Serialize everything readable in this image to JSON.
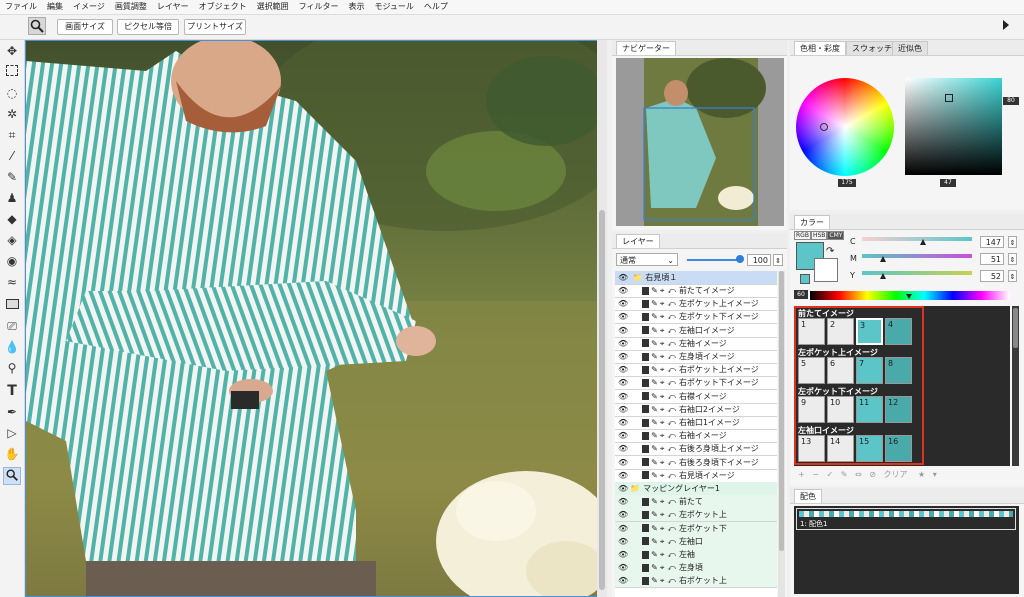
{
  "menu": [
    "ファイル",
    "編集",
    "イメージ",
    "画質調整",
    "レイヤー",
    "オブジェクト",
    "選択範囲",
    "フィルター",
    "表示",
    "モジュール",
    "ヘルプ"
  ],
  "options": {
    "fit_screen": "画面サイズ",
    "pixel_actual": "ピクセル等倍",
    "print_size": "プリントサイズ"
  },
  "navigator": {
    "tab": "ナビゲーター"
  },
  "layers": {
    "tab": "レイヤー",
    "blend_mode": "通常",
    "opacity": "100",
    "folder1": "右見頃１",
    "items1": [
      "前たてイメージ",
      "左ポケット上イメージ",
      "左ポケット下イメージ",
      "左袖口イメージ",
      "左袖イメージ",
      "左身頃イメージ",
      "右ポケット上イメージ",
      "右ポケット下イメージ",
      "右襟イメージ",
      "右袖口2イメージ",
      "右袖口1イメージ",
      "右袖イメージ",
      "右後ろ身頃上イメージ",
      "右後ろ身頃下イメージ",
      "右見頃イメージ"
    ],
    "folder2": "マッピングレイヤー1",
    "items2": [
      "前たて",
      "左ポケット上",
      "左ポケット下",
      "左袖口",
      "左袖",
      "左身頃",
      "右ポケット上"
    ]
  },
  "color_panel": {
    "tabs": [
      "色相・彩度",
      "スウォッチ",
      "近似色"
    ],
    "wheel_value": "175",
    "square_value": "47",
    "square_side_value": "80"
  },
  "color_model": {
    "tab": "カラー",
    "modes": [
      "RGB",
      "HSB",
      "CMY"
    ],
    "c_label": "C",
    "c_value": "147",
    "m_label": "M",
    "m_value": "51",
    "y_label": "Y",
    "y_value": "52",
    "scale_value": "60"
  },
  "mapping_groups": [
    {
      "title": "前たてイメージ",
      "cells": [
        "1",
        "2",
        "3",
        "4"
      ]
    },
    {
      "title": "左ポケット上イメージ",
      "cells": [
        "5",
        "6",
        "7",
        "8"
      ]
    },
    {
      "title": "左ポケット下イメージ",
      "cells": [
        "9",
        "10",
        "11",
        "12"
      ]
    },
    {
      "title": "左袖口イメージ",
      "cells": [
        "13",
        "14",
        "15",
        "16"
      ]
    }
  ],
  "mapping_footer": {
    "clear": "クリア"
  },
  "palette": {
    "tab": "配色",
    "item": "1: 配色1"
  },
  "colors": {
    "teal": "#5bc5c8",
    "teal_dark": "#4aa9a9",
    "light_cell": "#ececec",
    "highlight_red": "#e0301e",
    "selection_blue": "#4b8fd8"
  }
}
